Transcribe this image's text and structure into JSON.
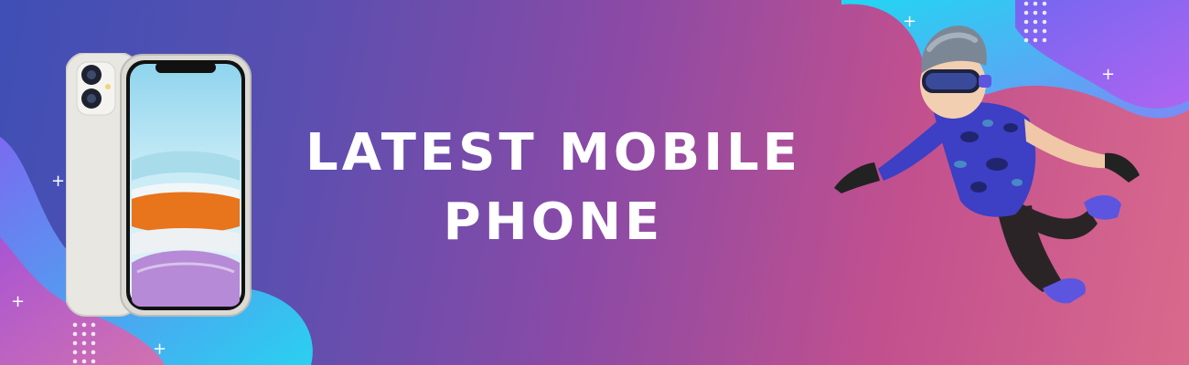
{
  "banner": {
    "title_line1": "LATEST MOBILE",
    "title_line2": "PHONE"
  },
  "decorations": {
    "plus_glyph": "+",
    "icons": [
      "smartphone-icon",
      "vr-character-icon",
      "plus-sparkle-icon",
      "dot-grid-icon"
    ]
  },
  "colors": {
    "gradient_start": "#3f4fb5",
    "gradient_mid": "#8a4aa6",
    "gradient_end": "#d96a8c",
    "accent_cyan": "#2ad0f0",
    "title_text": "#ffffff"
  }
}
